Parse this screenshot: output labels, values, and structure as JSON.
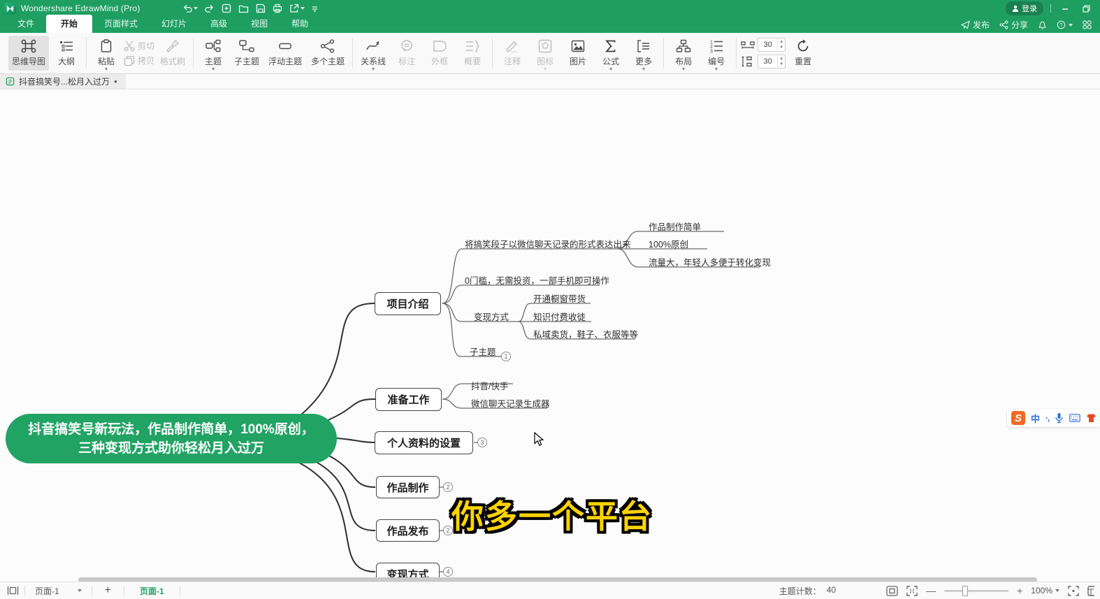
{
  "titlebar": {
    "app_title": "Wondershare EdrawMind (Pro)",
    "login_label": "登录"
  },
  "menubar": {
    "items": [
      {
        "label": "文件"
      },
      {
        "label": "开始"
      },
      {
        "label": "页面样式"
      },
      {
        "label": "幻灯片"
      },
      {
        "label": "高级"
      },
      {
        "label": "视图"
      },
      {
        "label": "帮助"
      }
    ],
    "publish_label": "发布",
    "share_label": "分享"
  },
  "toolbar": {
    "mindmap_label": "思维导图",
    "outline_label": "大纲",
    "paste_label": "粘贴",
    "cut_label": "剪切",
    "copy_label": "拷贝",
    "format_painter_label": "格式刷",
    "topic_label": "主题",
    "subtopic_label": "子主题",
    "floating_topic_label": "浮动主题",
    "multi_topic_label": "多个主题",
    "relation_label": "关系线",
    "callout_label": "标注",
    "boundary_label": "外框",
    "summary_label": "概要",
    "note_label": "注释",
    "icon_label": "图标",
    "picture_label": "图片",
    "formula_label": "公式",
    "more_label": "更多",
    "layout_label": "布局",
    "numbering_label": "编号",
    "h_spacing_value": "30",
    "v_spacing_value": "30",
    "reset_label": "重置"
  },
  "doc_tab": {
    "title": "抖音搞笑号...松月入过万"
  },
  "mindmap": {
    "central_topic": "抖音搞笑号新玩法，作品制作简单，100%原创，三种变现方式助你轻松月入过万",
    "branches": [
      {
        "label": "项目介绍",
        "children": [
          {
            "label": "将搞笑段子以微信聊天记录的形式表达出来",
            "children": [
              {
                "label": "作品制作简单"
              },
              {
                "label": "100%原创"
              },
              {
                "label": "流量大，年轻人多便于转化变现"
              }
            ]
          },
          {
            "label": "0门槛，无需投资，一部手机即可操作"
          },
          {
            "label": "变现方式",
            "children": [
              {
                "label": "开通橱窗带货"
              },
              {
                "label": "知识付费收徒"
              },
              {
                "label": "私域卖货，鞋子、衣服等等"
              }
            ]
          },
          {
            "label": "子主题",
            "badge": "1"
          }
        ]
      },
      {
        "label": "准备工作",
        "children": [
          {
            "label": "抖音/快手"
          },
          {
            "label": "微信聊天记录生成器"
          }
        ]
      },
      {
        "label": "个人资料的设置",
        "badge": "3"
      },
      {
        "label": "作品制作",
        "badge": "2"
      },
      {
        "label": "作品发布",
        "badge": "2"
      },
      {
        "label": "变现方式",
        "badge": "4"
      }
    ]
  },
  "subtitle_overlay": {
    "text": "你多一个平台"
  },
  "ime_bar": {
    "mode": "中",
    "punctuation": "·,"
  },
  "statusbar": {
    "page_select": "页面-1",
    "page_tab": "页面-1",
    "topic_count_label": "主题计数：",
    "topic_count": "40",
    "zoom_value": "100%"
  }
}
